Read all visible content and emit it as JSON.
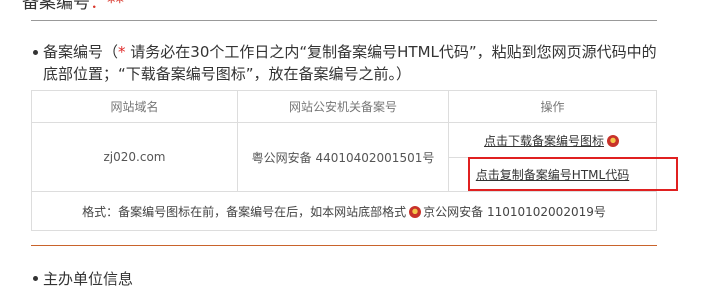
{
  "top_heading": {
    "text": "备案编号",
    "red_part": "：**"
  },
  "icp_section": {
    "title_prefix": "备案编号（",
    "star": "*",
    "title_rest": " 请务必在30个工作日之内“复制备案编号HTML代码”，粘贴到您网页源代码中的底部位置；“下载备案编号图标”，放在备案编号之前。）"
  },
  "table": {
    "headers": [
      "网站域名",
      "网站公安机关备案号",
      "操作"
    ],
    "domain": "zj020.com",
    "record_number": "粤公网安备 44010402001501号",
    "download_link": "点击下载备案编号图标",
    "copy_link": "点击复制备案编号HTML代码",
    "format_prefix": "格式：备案编号图标在前，备案编号在后，如本网站底部格式",
    "format_example": "京公网安备 11010102002019号"
  },
  "info_section": {
    "title": "主办单位信息"
  },
  "colors": {
    "highlight": "#e02020",
    "divider_accent": "#c9632b",
    "star": "#e02b2b"
  },
  "icons": {
    "police_emblem": "police-emblem-icon"
  }
}
